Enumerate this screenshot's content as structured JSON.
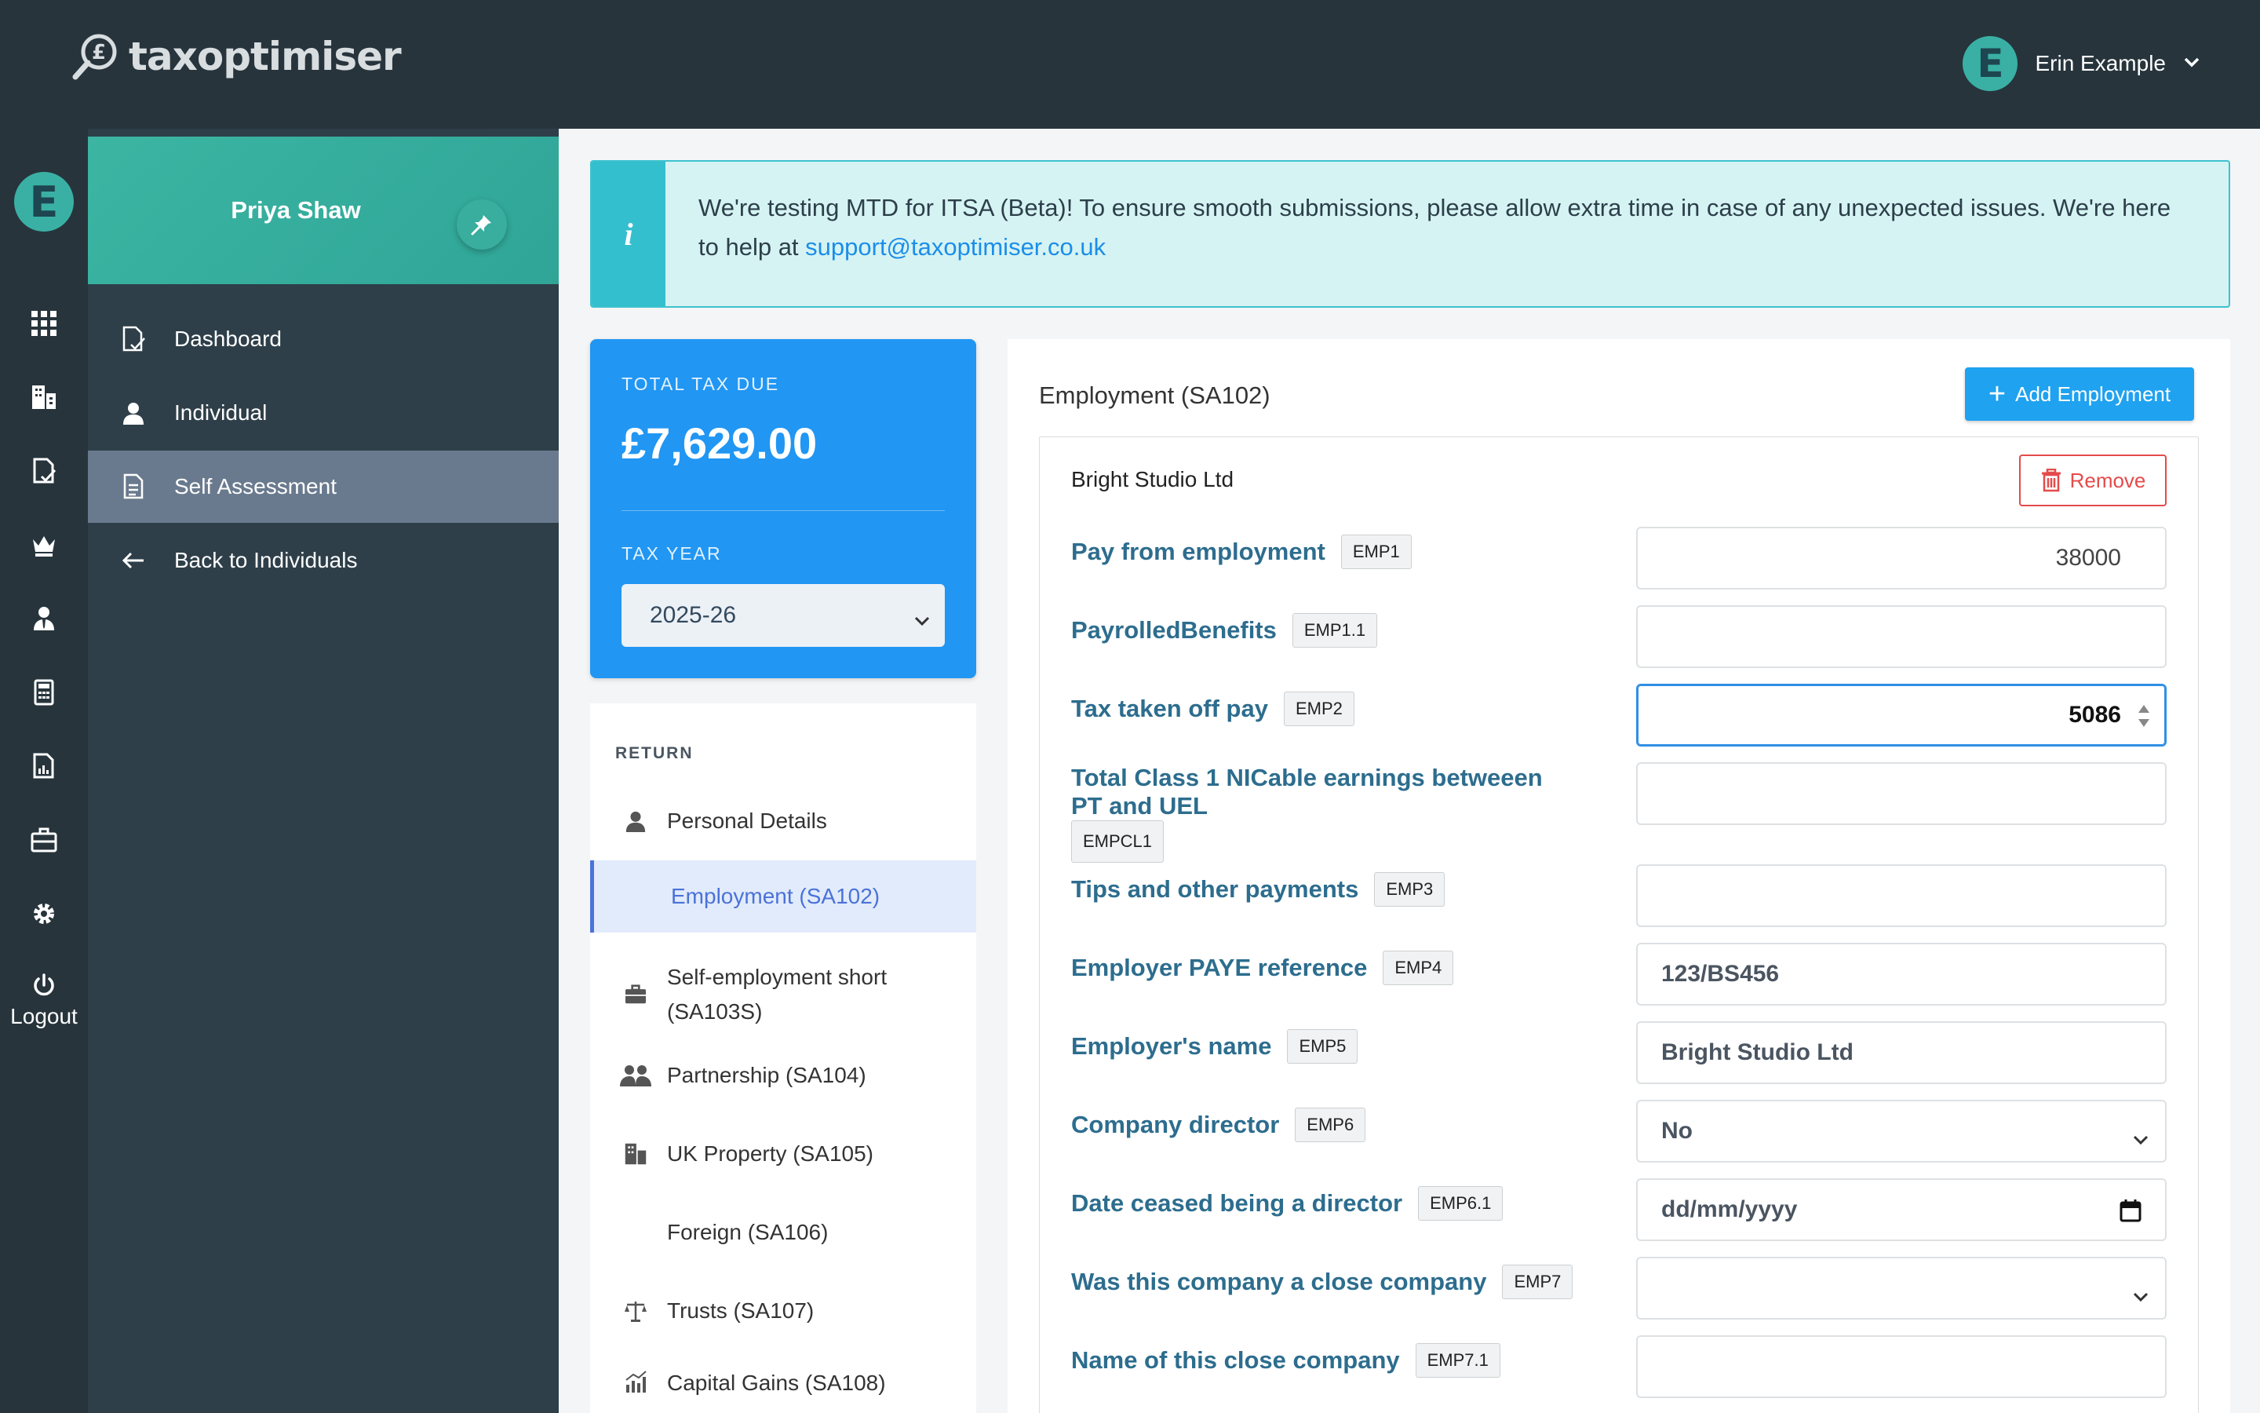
{
  "app": {
    "logo_text": "taxoptimiser",
    "user_initial": "E",
    "user_name": "Erin Example"
  },
  "rail": {
    "logout_label": "Logout",
    "icons": [
      "apps-grid-icon",
      "buildings-icon",
      "document-check-icon",
      "crown-icon",
      "user-tie-icon",
      "calculator-icon",
      "report-icon",
      "briefcase-icon",
      "gear-icon"
    ]
  },
  "sidebar": {
    "client_name": "Priya Shaw",
    "items": [
      {
        "label": "Dashboard",
        "icon": "document-check-icon"
      },
      {
        "label": "Individual",
        "icon": "user-icon"
      },
      {
        "label": "Self Assessment",
        "icon": "document-icon",
        "active": true
      },
      {
        "label": "Back to Individuals",
        "icon": "arrow-left-icon"
      }
    ]
  },
  "notice": {
    "icon_glyph": "i",
    "text": "We're testing MTD for ITSA (Beta)! To ensure smooth submissions, please allow extra time in case of any unexpected issues. We're here to help at ",
    "link": "support@taxoptimiser.co.uk"
  },
  "tax": {
    "total_label": "TOTAL TAX DUE",
    "total_value": "£7,629.00",
    "year_label": "TAX YEAR",
    "year_value": "2025-26"
  },
  "return_nav": {
    "header": "RETURN",
    "items": [
      {
        "label": "Personal Details",
        "icon": "user-icon"
      },
      {
        "label": "Employment (SA102)",
        "icon": "",
        "active": true
      },
      {
        "label": "Self-employment short (SA103S)",
        "icon": "briefcase-icon"
      },
      {
        "label": "Partnership (SA104)",
        "icon": "users-icon"
      },
      {
        "label": "UK Property (SA105)",
        "icon": "buildings-icon"
      },
      {
        "label": "Foreign (SA106)",
        "icon": ""
      },
      {
        "label": "Trusts (SA107)",
        "icon": "scales-icon"
      },
      {
        "label": "Capital Gains (SA108)",
        "icon": "chart-icon"
      }
    ]
  },
  "employment": {
    "title": "Employment (SA102)",
    "add_label": "Add Employment",
    "employer_name": "Bright Studio Ltd",
    "remove_label": "Remove",
    "fields": [
      {
        "label": "Pay from employment",
        "code": "EMP1",
        "value": "38000"
      },
      {
        "label": "PayrolledBenefits",
        "code": "EMP1.1",
        "value": ""
      },
      {
        "label": "Tax taken off pay",
        "code": "EMP2",
        "value": "5086"
      },
      {
        "label": "Total Class 1 NICable earnings betweeen PT and UEL",
        "code": "EMPCL1",
        "value": ""
      },
      {
        "label": "Tips and other payments",
        "code": "EMP3",
        "value": ""
      },
      {
        "label": "Employer PAYE reference",
        "code": "EMP4",
        "value": "123/BS456"
      },
      {
        "label": "Employer's name",
        "code": "EMP5",
        "value": "Bright Studio Ltd"
      },
      {
        "label": "Company director",
        "code": "EMP6",
        "value": "No"
      },
      {
        "label": "Date ceased being a director",
        "code": "EMP6.1",
        "value": "dd/mm/yyyy"
      },
      {
        "label": "Was this company a close company",
        "code": "EMP7",
        "value": ""
      },
      {
        "label": "Name of this close company",
        "code": "EMP7.1",
        "value": ""
      }
    ]
  },
  "colors": {
    "topbar": "#27343c",
    "sidebar": "#2e3f49",
    "teal": "#3ab0a5",
    "primary_blue": "#2196f3",
    "label_blue": "#2d6d8e",
    "remove_red": "#e44b4b"
  }
}
